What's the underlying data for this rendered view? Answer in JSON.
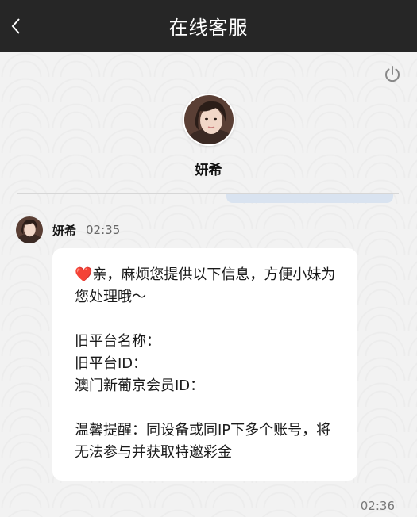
{
  "header": {
    "title": "在线客服",
    "back_icon": "chevron-left-icon"
  },
  "toolbar": {
    "power_icon": "power-icon"
  },
  "agent": {
    "name": "妍希"
  },
  "message": {
    "sender": "妍希",
    "time": "02:35",
    "heart": "❤️",
    "line1": "亲，麻烦您提供以下信息，方便小妹为您处理哦～",
    "field1": "旧平台名称：",
    "field2": "旧平台ID：",
    "field3": "澳门新葡京会员ID：",
    "tip": "温馨提醒：同设备或同IP下多个账号，将无法参与并获取特邀彩金"
  },
  "footer": {
    "time": "02:36"
  },
  "colors": {
    "header_bg": "#262626",
    "heart": "#e02a3a",
    "bubble_bg": "#ffffff"
  }
}
